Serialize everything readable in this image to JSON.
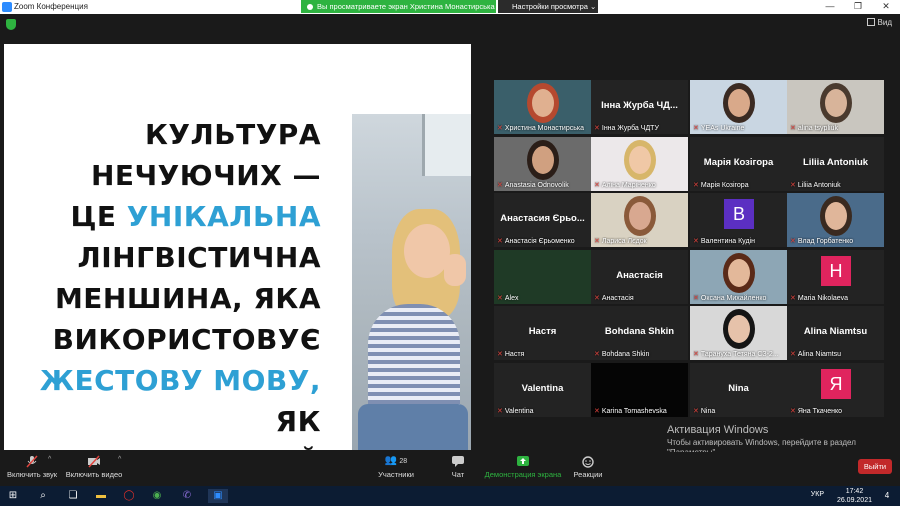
{
  "titlebar": {
    "app_title": "Zoom Конференция",
    "share_banner": "Вы просматриваете экран Христина Монастирська",
    "view_options": "Настройки просмотра",
    "minimize": "—",
    "maximize": "❐",
    "close": "✕"
  },
  "topstrip": {
    "view_label": "Вид"
  },
  "slide": {
    "line1": "КУЛЬТУРА",
    "line2": "НЕЧУЮЧИХ —",
    "line3a": "ЦЕ",
    "line3b": "УНІКАЛЬНА",
    "line4": "ЛІНГВІСТИЧНА",
    "line5": "МЕНШИНА, ЯКА",
    "line6": "ВИКОРИСТОВУЄ",
    "line7a": "ЖЕСТОВУ МОВУ,",
    "line7b": "ЯК",
    "line8": "ПЕРВИННИЙ МЕТОД",
    "accent_color": "#2ea0d4"
  },
  "gallery": {
    "tiles": [
      {
        "big": "",
        "name": "Христина Монастирська"
      },
      {
        "big": "Інна Журба ЧД...",
        "name": "Інна Журба ЧДТУ"
      },
      {
        "big": "",
        "name": "YEAs Ukraine"
      },
      {
        "big": "",
        "name": "alina tsypliuk"
      },
      {
        "big": "",
        "name": "Anastasia Odnovolik"
      },
      {
        "big": "",
        "name": "Аліна Маріненко"
      },
      {
        "big": "Марія Козігора",
        "name": "Марія Козігора"
      },
      {
        "big": "Liliia Antoniuk",
        "name": "Liliia Antoniuk"
      },
      {
        "big": "Анастасия Єрьо...",
        "name": "Анастасія Єрьоменко"
      },
      {
        "big": "",
        "name": "Лариса Лєдок"
      },
      {
        "big": "",
        "name": "Валентина Кудін",
        "avatar": "B"
      },
      {
        "big": "",
        "name": "Влад Горбатенко"
      },
      {
        "big": "",
        "name": "Alex"
      },
      {
        "big": "Анастасія",
        "name": "Анастасія"
      },
      {
        "big": "",
        "name": "Оксана Михайленко"
      },
      {
        "big": "",
        "name": "Maria Nikolaeva",
        "avatar": "H"
      },
      {
        "big": "Настя",
        "name": "Настя"
      },
      {
        "big": "Bohdana Shkin",
        "name": "Bohdana Shkin"
      },
      {
        "big": "",
        "name": "Тарануха Тетяна СЗ-2..."
      },
      {
        "big": "Alina Niamtsu",
        "name": "Alina Niamtsu"
      },
      {
        "big": "Valentina",
        "name": "Valentina"
      },
      {
        "big": "",
        "name": "Karina Tomashevska"
      },
      {
        "big": "Nina",
        "name": "Nina"
      },
      {
        "big": "",
        "name": "Яна Ткаченко",
        "avatar": "Я"
      }
    ]
  },
  "watermark": {
    "title": "Активация Windows",
    "text": "Чтобы активировать Windows, перейдите в раздел \"Параметры\"."
  },
  "toolbar": {
    "audio": "Включить звук",
    "video": "Включить видео",
    "participants": "Участники",
    "participants_count": "28",
    "chat": "Чат",
    "share": "Демонстрация экрана",
    "reactions": "Реакции",
    "exit": "Выйти"
  },
  "taskbar": {
    "lang": "УКР",
    "time": "17:42",
    "date": "26.09.2021",
    "notif": "4"
  }
}
